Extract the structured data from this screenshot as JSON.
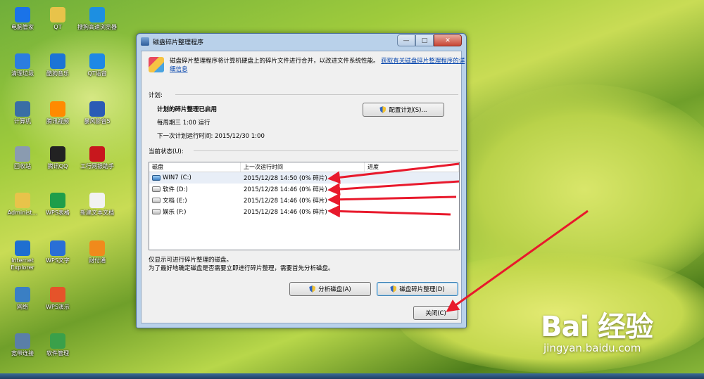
{
  "desktop": {
    "icons": [
      {
        "label": "电脑管家",
        "icon": "shield-icon",
        "color": "#1a73e8"
      },
      {
        "label": "QT",
        "icon": "folder-icon",
        "color": "#e8c34a"
      },
      {
        "label": "搜狗高速浏览器",
        "icon": "browser-icon",
        "color": "#1d8fe1"
      },
      {
        "label": "清理垃圾",
        "icon": "broom-icon",
        "color": "#2b7de0"
      },
      {
        "label": "酷狗音乐",
        "icon": "music-icon",
        "color": "#1b74d6"
      },
      {
        "label": "QT语音",
        "icon": "voice-icon",
        "color": "#1e88e5"
      },
      {
        "label": "计算机",
        "icon": "computer-icon",
        "color": "#3a6ea5"
      },
      {
        "label": "腾讯视频",
        "icon": "video-icon",
        "color": "#ff8a00"
      },
      {
        "label": "暴风影音5",
        "icon": "media-icon",
        "color": "#2a5bb5"
      },
      {
        "label": "回收站",
        "icon": "recycle-bin-icon",
        "color": "#8a9bb0"
      },
      {
        "label": "腾讯QQ",
        "icon": "qq-icon",
        "color": "#222222"
      },
      {
        "label": "工行网银助手",
        "icon": "bank-icon",
        "color": "#c8171d"
      },
      {
        "label": "Administ...",
        "icon": "user-folder-icon",
        "color": "#e8c34a"
      },
      {
        "label": "WPS表格",
        "icon": "wps-sheet-icon",
        "color": "#1e9e4a"
      },
      {
        "label": "新建文本文档",
        "icon": "text-file-icon",
        "color": "#f2f2f2"
      },
      {
        "label": "Internet Explorer",
        "icon": "ie-icon",
        "color": "#1f6fd0"
      },
      {
        "label": "WPS文字",
        "icon": "wps-writer-icon",
        "color": "#2a6fd6"
      },
      {
        "label": "财付通",
        "icon": "tenpay-icon",
        "color": "#f08a1c"
      },
      {
        "label": "网络",
        "icon": "network-icon",
        "color": "#3a7fc4"
      },
      {
        "label": "WPS演示",
        "icon": "wps-present-icon",
        "color": "#e5532a"
      },
      {
        "label": "宽带连接",
        "icon": "broadband-icon",
        "color": "#5a7fa8"
      },
      {
        "label": "软件管理",
        "icon": "software-manager-icon",
        "color": "#3aa04a"
      }
    ]
  },
  "dialog": {
    "title": "磁盘碎片整理程序",
    "intro_text": "磁盘碎片整理程序将计算机硬盘上的碎片文件进行合并，以改进文件系统性能。",
    "intro_link": "获取有关磁盘碎片整理程序的详细信息",
    "schedule_label": "计划:",
    "schedule_status": "计划的碎片整理已启用",
    "schedule_freq": "每周期三  1:00 运行",
    "schedule_next": "下一次计划运行时间: 2015/12/30 1:00",
    "configure_button": "配置计划(S)...",
    "status_label": "当前状态(U):",
    "columns": [
      "磁盘",
      "上一次运行时间",
      "进度"
    ],
    "disks": [
      {
        "name": "WIN7 (C:)",
        "last_run": "2015/12/28 14:50 (0% 碎片)",
        "progress": "",
        "system": true
      },
      {
        "name": "软件 (D:)",
        "last_run": "2015/12/28 14:46 (0% 碎片)",
        "progress": "",
        "system": false
      },
      {
        "name": "文档 (E:)",
        "last_run": "2015/12/28 14:46 (0% 碎片)",
        "progress": "",
        "system": false
      },
      {
        "name": "娱乐 (F:)",
        "last_run": "2015/12/28 14:46 (0% 碎片)",
        "progress": "",
        "system": false
      }
    ],
    "note1": "仅显示可进行碎片整理的磁盘。",
    "note2": "为了最好地确定磁盘是否需要立即进行碎片整理，需要首先分析磁盘。",
    "analyze_button": "分析磁盘(A)",
    "defrag_button": "磁盘碎片整理(D)",
    "close_button": "关闭(C)"
  },
  "watermark": {
    "logo": "Bai  经验",
    "url": "jingyan.baidu.com"
  },
  "colors": {
    "arrow": "#e8192c",
    "link": "#0645ad"
  }
}
